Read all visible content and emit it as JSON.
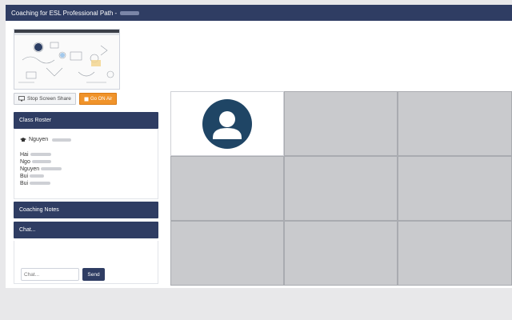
{
  "window": {
    "title": "Coaching for ESL Professional Path -"
  },
  "screen_share": {
    "stop_label": "Stop Screen Share",
    "go_air_label": "Go ON Air"
  },
  "roster": {
    "title": "Class Roster",
    "host": "Nguyen",
    "members": [
      "Hai",
      "Ngo",
      "Nguyen",
      "Bui",
      "Bui"
    ]
  },
  "coaching_notes": {
    "title": "Coaching Notes"
  },
  "chat": {
    "title": "Chat...",
    "placeholder": "Chat...",
    "send_label": "Send"
  },
  "colors": {
    "header": "#2f3d63",
    "accent": "#f0932a",
    "tile": "#c9cacd",
    "avatar": "#1f4565"
  },
  "video_grid": {
    "tiles": [
      {
        "state": "active",
        "icon": "user-avatar-icon"
      },
      {
        "state": "empty"
      },
      {
        "state": "empty"
      },
      {
        "state": "empty"
      },
      {
        "state": "empty"
      },
      {
        "state": "empty"
      },
      {
        "state": "empty"
      },
      {
        "state": "empty"
      },
      {
        "state": "empty"
      }
    ]
  }
}
